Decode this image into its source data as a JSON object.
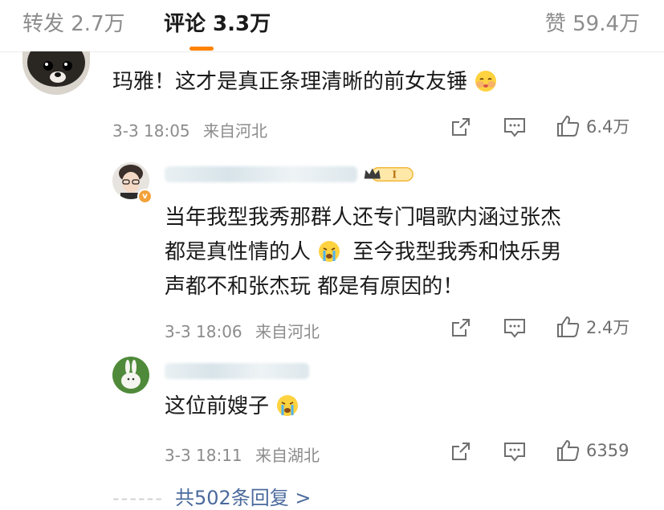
{
  "tabs": {
    "repost": "转发 2.7万",
    "comment": "评论 3.3万",
    "like": "赞 59.4万"
  },
  "colors": {
    "accent": "#ff8200",
    "link": "#4b6a9d",
    "meta_gray": "#8c8c8c"
  },
  "comments": [
    {
      "text": "玛雅！这才是真正条理清晰的前女友锤",
      "emoji": "blush-cover-face-emoji",
      "time": "3-3 18:05",
      "location": "来自河北",
      "likes": "6.4万"
    },
    {
      "lines": [
        "当年我型我秀那群人还专门唱歌内涵过张杰",
        "都是真性情的人",
        "至今我型我秀和快乐男",
        "声都不和张杰玩 都是有原因的！"
      ],
      "emoji": "crying-emoji",
      "time": "3-3 18:06",
      "location": "来自河北",
      "likes": "2.4万",
      "badge_label": "I"
    },
    {
      "text": "这位前嫂子",
      "emoji": "crying-emoji",
      "time": "3-3 18:11",
      "location": "来自湖北",
      "likes": "6359"
    }
  ],
  "more_replies": "共502条回复 >"
}
